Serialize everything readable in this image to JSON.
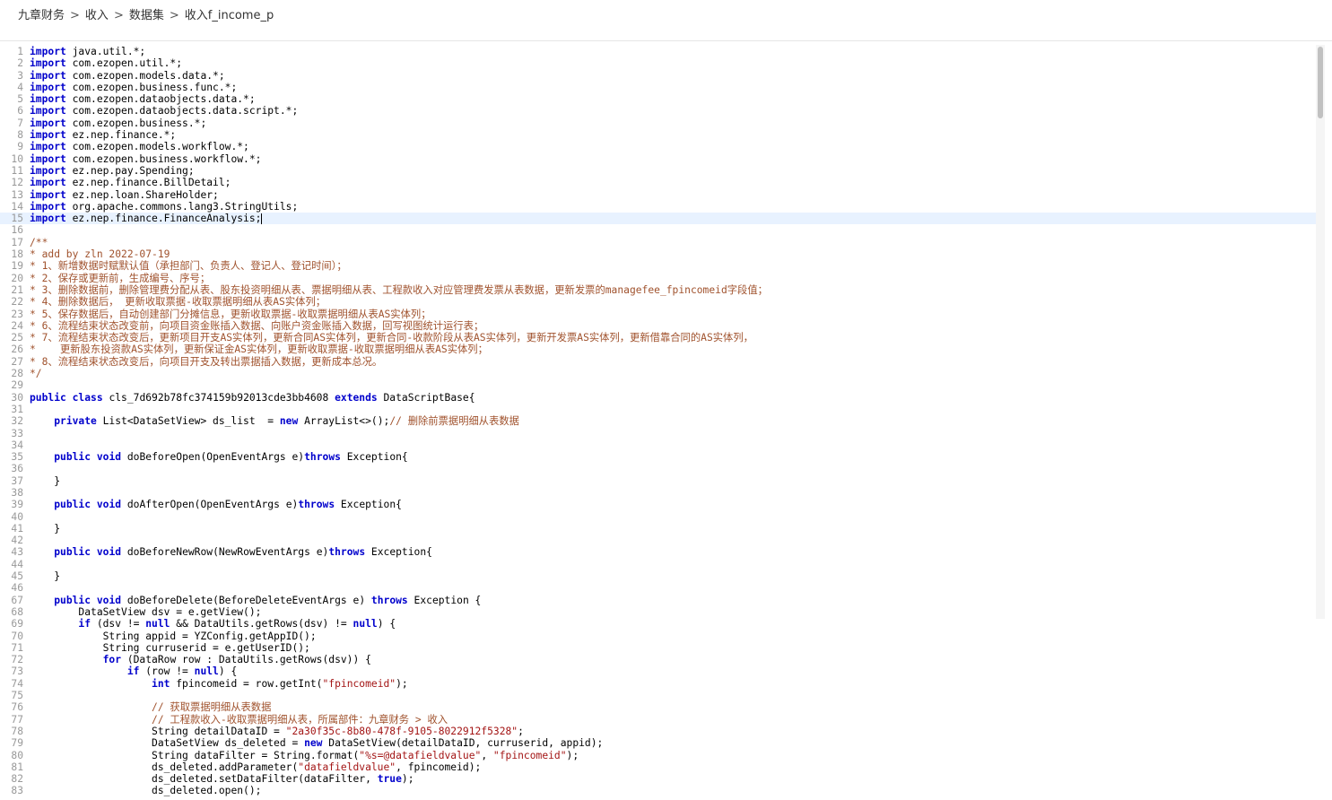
{
  "breadcrumb": {
    "items": [
      "九章财务",
      "收入",
      "数据集",
      "收入f_income_p"
    ],
    "separator": ">"
  },
  "editor": {
    "active_line": 15,
    "lines": [
      {
        "n": "1",
        "t": "import java.util.*;"
      },
      {
        "n": "2",
        "t": "import com.ezopen.util.*;"
      },
      {
        "n": "3",
        "t": "import com.ezopen.models.data.*;"
      },
      {
        "n": "4",
        "t": "import com.ezopen.business.func.*;"
      },
      {
        "n": "5",
        "t": "import com.ezopen.dataobjects.data.*;"
      },
      {
        "n": "6",
        "t": "import com.ezopen.dataobjects.data.script.*;"
      },
      {
        "n": "7",
        "t": "import com.ezopen.business.*;"
      },
      {
        "n": "8",
        "t": "import ez.nep.finance.*;"
      },
      {
        "n": "9",
        "t": "import com.ezopen.models.workflow.*;"
      },
      {
        "n": "10",
        "t": "import com.ezopen.business.workflow.*;"
      },
      {
        "n": "11",
        "t": "import ez.nep.pay.Spending;"
      },
      {
        "n": "12",
        "t": "import ez.nep.finance.BillDetail;"
      },
      {
        "n": "13",
        "t": "import ez.nep.loan.ShareHolder;"
      },
      {
        "n": "14",
        "t": "import org.apache.commons.lang3.StringUtils;"
      },
      {
        "n": "15",
        "t": "import ez.nep.finance.FinanceAnalysis;"
      },
      {
        "n": "16",
        "t": ""
      },
      {
        "n": "17",
        "t": "/**"
      },
      {
        "n": "18",
        "t": "* add by zln 2022-07-19"
      },
      {
        "n": "19",
        "t": "* 1、新增数据时赋默认值（承担部门、负责人、登记人、登记时间）；"
      },
      {
        "n": "20",
        "t": "* 2、保存或更新前，生成编号、序号；"
      },
      {
        "n": "21",
        "t": "* 3、删除数据前，删除管理费分配从表、股东投资明细从表、票据明细从表、工程款收入对应管理费发票从表数据，更新发票的managefee_fpincomeid字段值；"
      },
      {
        "n": "22",
        "t": "* 4、删除数据后， 更新收取票据-收取票据明细从表AS实体列；"
      },
      {
        "n": "23",
        "t": "* 5、保存数据后，自动创建部门分摊信息，更新收取票据-收取票据明细从表AS实体列；"
      },
      {
        "n": "24",
        "t": "* 6、流程结束状态改变前，向项目资金账插入数据、向账户资金账插入数据，回写视图统计运行表；"
      },
      {
        "n": "25",
        "t": "* 7、流程结束状态改变后，更新项目开支AS实体列，更新合同AS实体列，更新合同-收款阶段从表AS实体列，更新开发票AS实体列，更新借靠合同的AS实体列，"
      },
      {
        "n": "26",
        "t": "*    更新股东投资款AS实体列，更新保证金AS实体列，更新收取票据-收取票据明细从表AS实体列；"
      },
      {
        "n": "27",
        "t": "* 8、流程结束状态改变后，向项目开支及转出票据插入数据，更新成本总况。"
      },
      {
        "n": "28",
        "t": "*/"
      },
      {
        "n": "29",
        "t": ""
      },
      {
        "n": "30",
        "t": "public class cls_7d692b78fc374159b92013cde3bb4608 extends DataScriptBase{"
      },
      {
        "n": "31",
        "t": ""
      },
      {
        "n": "32",
        "t": "    private List<DataSetView> ds_list  = new ArrayList<>();// 删除前票据明细从表数据"
      },
      {
        "n": "33",
        "t": ""
      },
      {
        "n": "34",
        "t": ""
      },
      {
        "n": "35",
        "t": "    public void doBeforeOpen(OpenEventArgs e)throws Exception{"
      },
      {
        "n": "36",
        "t": ""
      },
      {
        "n": "37",
        "t": "    }"
      },
      {
        "n": "38",
        "t": ""
      },
      {
        "n": "39",
        "t": "    public void doAfterOpen(OpenEventArgs e)throws Exception{"
      },
      {
        "n": "40",
        "t": ""
      },
      {
        "n": "41",
        "t": "    }"
      },
      {
        "n": "42",
        "t": ""
      },
      {
        "n": "43",
        "t": "    public void doBeforeNewRow(NewRowEventArgs e)throws Exception{"
      },
      {
        "n": "44",
        "t": ""
      },
      {
        "n": "45",
        "t": "    }"
      },
      {
        "n": "46",
        "t": ""
      },
      {
        "n": "67",
        "t": "    public void doBeforeDelete(BeforeDeleteEventArgs e) throws Exception {"
      },
      {
        "n": "68",
        "t": "        DataSetView dsv = e.getView();"
      },
      {
        "n": "69",
        "t": "        if (dsv != null && DataUtils.getRows(dsv) != null) {"
      },
      {
        "n": "70",
        "t": "            String appid = YZConfig.getAppID();"
      },
      {
        "n": "71",
        "t": "            String curruserid = e.getUserID();"
      },
      {
        "n": "72",
        "t": "            for (DataRow row : DataUtils.getRows(dsv)) {"
      },
      {
        "n": "73",
        "t": "                if (row != null) {"
      },
      {
        "n": "74",
        "t": "                    int fpincomeid = row.getInt(\"fpincomeid\");"
      },
      {
        "n": "75",
        "t": ""
      },
      {
        "n": "76",
        "t": "                    // 获取票据明细从表数据"
      },
      {
        "n": "77",
        "t": "                    // 工程款收入-收取票据明细从表，所属部件：九章财务 > 收入"
      },
      {
        "n": "78",
        "t": "                    String detailDataID = \"2a30f35c-8b80-478f-9105-8022912f5328\";"
      },
      {
        "n": "79",
        "t": "                    DataSetView ds_deleted = new DataSetView(detailDataID, curruserid, appid);"
      },
      {
        "n": "80",
        "t": "                    String dataFilter = String.format(\"%s=@datafieldvalue\", \"fpincomeid\");"
      },
      {
        "n": "81",
        "t": "                    ds_deleted.addParameter(\"datafieldvalue\", fpincomeid);"
      },
      {
        "n": "82",
        "t": "                    ds_deleted.setDataFilter(dataFilter, true);"
      },
      {
        "n": "83",
        "t": "                    ds_deleted.open();"
      }
    ]
  }
}
